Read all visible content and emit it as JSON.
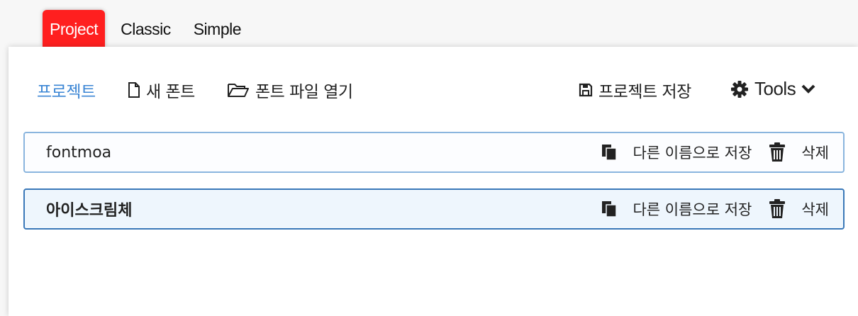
{
  "tabs": [
    "Project",
    "Classic",
    "Simple"
  ],
  "toolbar": {
    "project_label": "프로젝트",
    "new_font_label": "새 폰트",
    "open_font_label": "폰트 파일 열기",
    "save_project_label": "프로젝트 저장",
    "tools_label": "Tools"
  },
  "projects": [
    {
      "name": "fontmoa",
      "save_as_label": "다른 이름으로 저장",
      "delete_label": "삭제"
    },
    {
      "name": "아이스크림체",
      "save_as_label": "다른 이름으로 저장",
      "delete_label": "삭제"
    }
  ],
  "colors": {
    "active_tab": "#ff1f1f",
    "accent": "#3a85d4",
    "row_border": "#8ab5de",
    "selected_row_bg": "#eef6fd"
  },
  "icons": [
    "file-icon",
    "folder-open-icon",
    "save-icon",
    "gear-icon",
    "chevron-down-icon",
    "copy-icon",
    "trash-icon"
  ]
}
